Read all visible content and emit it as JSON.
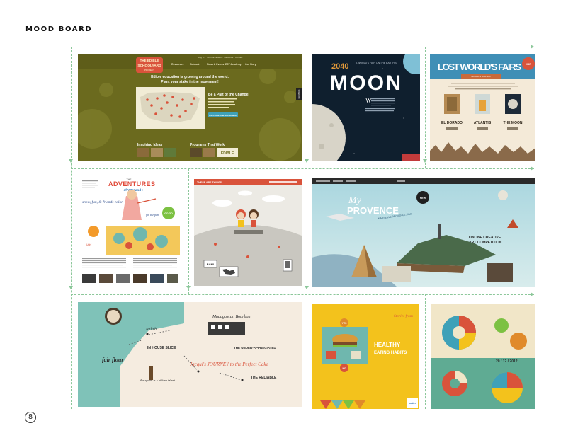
{
  "page": {
    "title": "MOOD BOARD",
    "page_number": "8"
  },
  "tiles": {
    "edible": {
      "logo_line1": "THE EDIBLE",
      "logo_line2": "SCHOOLYARD",
      "logo_line3": "PROJECT",
      "nav": [
        "Resources",
        "Network",
        "News & Events",
        "ESY Academy",
        "Our Story"
      ],
      "topnav": [
        "Log In",
        "Join the Network",
        "Subscribe",
        "Contact"
      ],
      "headline1": "Edible education is growing around the world.",
      "headline2": "Plant your stake in the movement!",
      "side_title": "Be a Part of the Change!",
      "cta": "EXPLORE THE MOVEMENT",
      "section1": "Inspiring Ideas",
      "section2": "Programs That Work",
      "side_tab": "FEEDBACK",
      "badge": "EDIBLE"
    },
    "moon": {
      "number": "2040",
      "title": "MOON",
      "subtitle": "A WORLD'S FAIR ON THE EARTH'S",
      "drop_cap": "W"
    },
    "lost": {
      "title": "LOST WORLD'S FAIRS",
      "ribbon": "WORLD'S FAIR MIX",
      "badge": "VISIT",
      "items": [
        "EL DORADO",
        "ATLANTIS",
        "THE MOON"
      ]
    },
    "adventures": {
      "title_top": "THE",
      "title": "ADVENTURES",
      "title_sub": "of YOU and I",
      "handwritten1": "snow, fun, & friends color",
      "handwritten2": "for the pan",
      "handwritten3": "Ugh!",
      "badge": "GO GO"
    },
    "thesethings": {
      "brand": "THESE ARE THINGS",
      "sign": "BAM!"
    },
    "provence": {
      "title_line1": "My",
      "title_line2": "PROVENCE",
      "subtitle": "MARSEILLE PROVENCE 2013",
      "right1": "ONLINE CREATIVE",
      "right2": "ART COMPETITION",
      "badge": "NEW"
    },
    "food": {
      "title1": "Madagascan Bourbon",
      "label1": "Relish",
      "label2": "fair flour",
      "label3": "IN HOUSE SLICE",
      "label4": "the spoon is a hidden talent",
      "label5": "THE RELIABLE",
      "label6": "Jacqui's JOURNEY to the Perfect Cake",
      "label7": "THE UNDER-APPRECIATED"
    },
    "healthy": {
      "title1": "HEALTHY",
      "title2": "EATING HABITS",
      "script": "Stories from",
      "brand": "bakin",
      "circle1": "YES",
      "circle2": "NO"
    },
    "circles": {
      "date": "20 / 12 / 2012"
    }
  },
  "colors": {
    "guide": "#8cc79a",
    "olive": "#6b6a1e",
    "navy": "#0f1f2e",
    "cream": "#f4ead8",
    "teal": "#6fb7ae",
    "yellow": "#f3c21c"
  }
}
